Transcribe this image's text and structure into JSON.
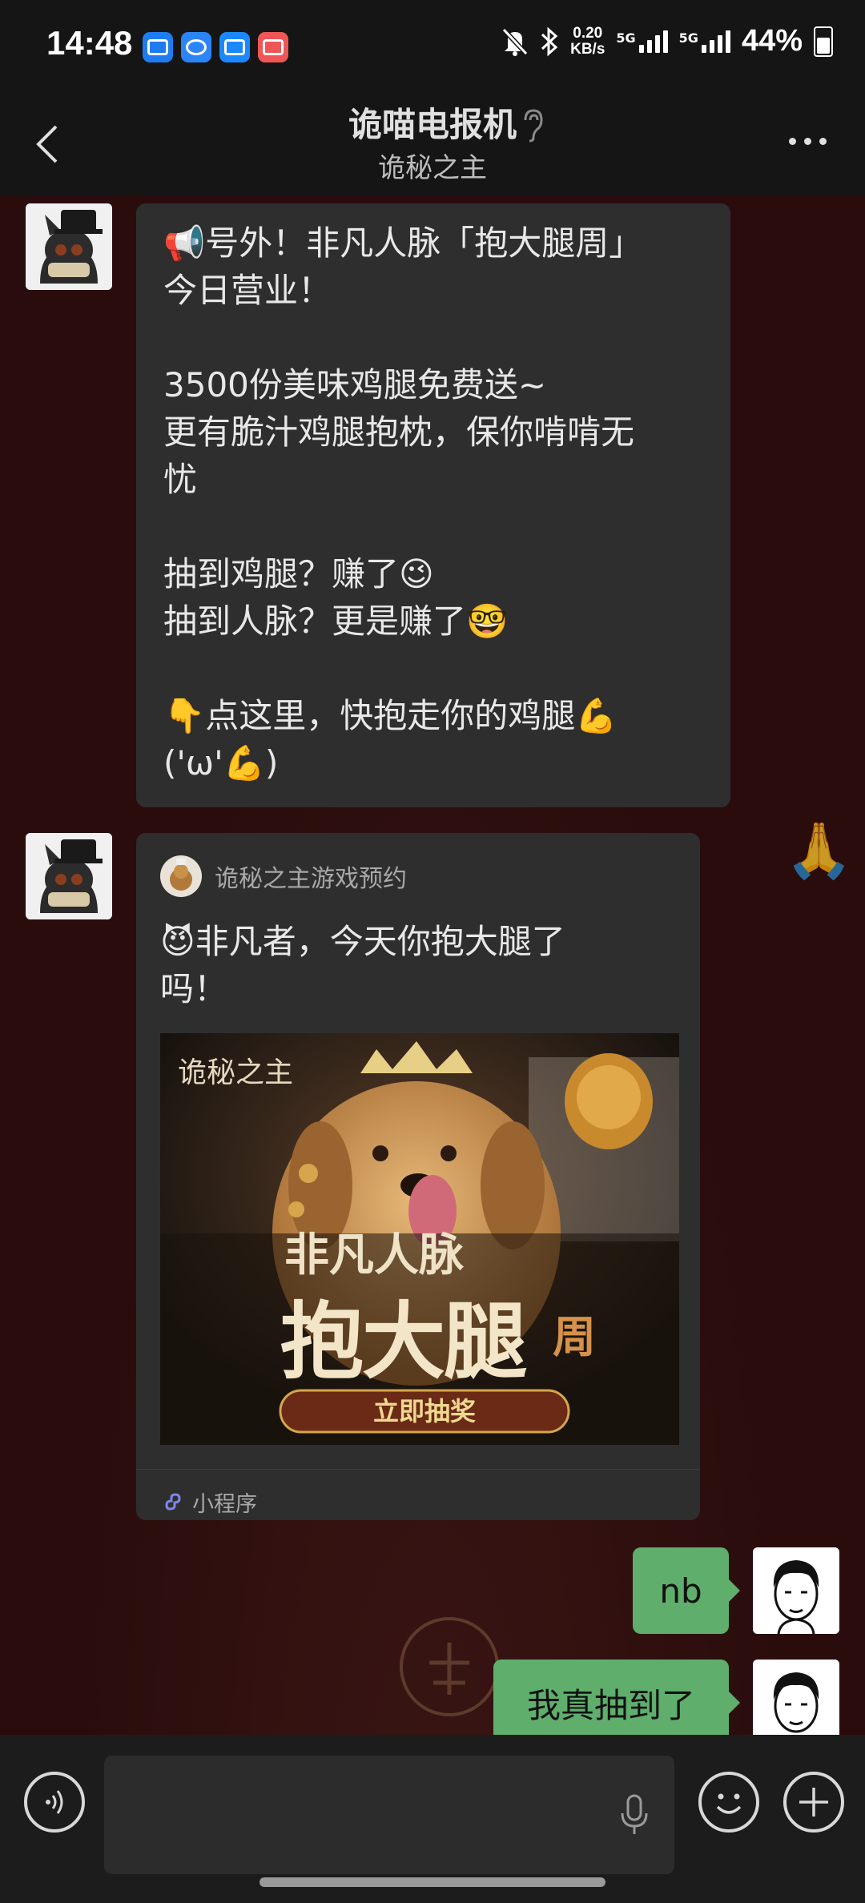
{
  "status_bar": {
    "time": "14:48",
    "net_speed_value": "0.20",
    "net_speed_unit": "KB/s",
    "signal1_label": "5G",
    "signal2_label": "5G",
    "battery": "44%"
  },
  "header": {
    "title": "诡喵电报机",
    "subtitle": "诡秘之主"
  },
  "messages": {
    "text_message": "📢号外！非凡人脉「抱大腿周」\n今日营业！\n\n3500份美味鸡腿免费送~\n更有脆汁鸡腿抱枕，保你啃啃无\n忧\n\n抽到鸡腿？赚了😉\n抽到人脉？更是赚了🤓\n\n👇点这里，快抱走你的鸡腿💪\n('ω'💪)",
    "mini_program": {
      "source_name": "诡秘之主游戏预约",
      "title": "😈非凡者，今天你抱大腿了吗！",
      "image_logo": "诡秘之主",
      "image_line1": "非凡人脉",
      "image_line2": "抱大腿",
      "image_badge": "周",
      "image_button": "立即抽奖",
      "footer_label": "小程序"
    },
    "user_msg_1": "nb",
    "user_msg_2": "我真抽到了"
  },
  "colors": {
    "green_bubble": "#5fae6c",
    "incoming_bubble": "#2e2e2e",
    "chat_bg": "#2a0c0c"
  },
  "icons": [
    "back-icon",
    "ear-icon",
    "more-icon",
    "voice-icon",
    "mic-icon",
    "emoji-icon",
    "plus-icon"
  ]
}
